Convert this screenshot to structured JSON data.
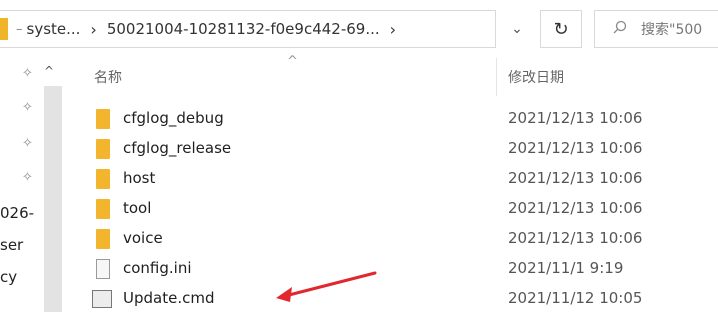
{
  "address": {
    "dash": "–",
    "segment_1": "syste...",
    "chevron_1": "›",
    "segment_2": "50021004-10281132-f0e9c442-69...",
    "chevron_2": "›"
  },
  "dropdown_glyph": "⌄",
  "refresh_glyph": "↻",
  "search": {
    "placeholder": "搜索\"500",
    "icon": "search-icon"
  },
  "nav": {
    "caret": "^",
    "pin_glyph": "✧",
    "fragments": [
      "026-",
      "ser",
      "cy"
    ]
  },
  "columns": {
    "name": "名称",
    "modified": "修改日期",
    "sort_glyph": "^"
  },
  "files": [
    {
      "name": "cfglog_debug",
      "modified": "2021/12/13 10:06",
      "kind": "folder"
    },
    {
      "name": "cfglog_release",
      "modified": "2021/12/13 10:06",
      "kind": "folder"
    },
    {
      "name": "host",
      "modified": "2021/12/13 10:06",
      "kind": "folder"
    },
    {
      "name": "tool",
      "modified": "2021/12/13 10:06",
      "kind": "folder"
    },
    {
      "name": "voice",
      "modified": "2021/12/13 10:06",
      "kind": "folder"
    },
    {
      "name": "config.ini",
      "modified": "2021/11/1 9:19",
      "kind": "file"
    },
    {
      "name": "Update.cmd",
      "modified": "2021/11/12 10:05",
      "kind": "cmd"
    }
  ],
  "colors": {
    "annotation_arrow": "#e0282e",
    "folder": "#f3b52e"
  }
}
